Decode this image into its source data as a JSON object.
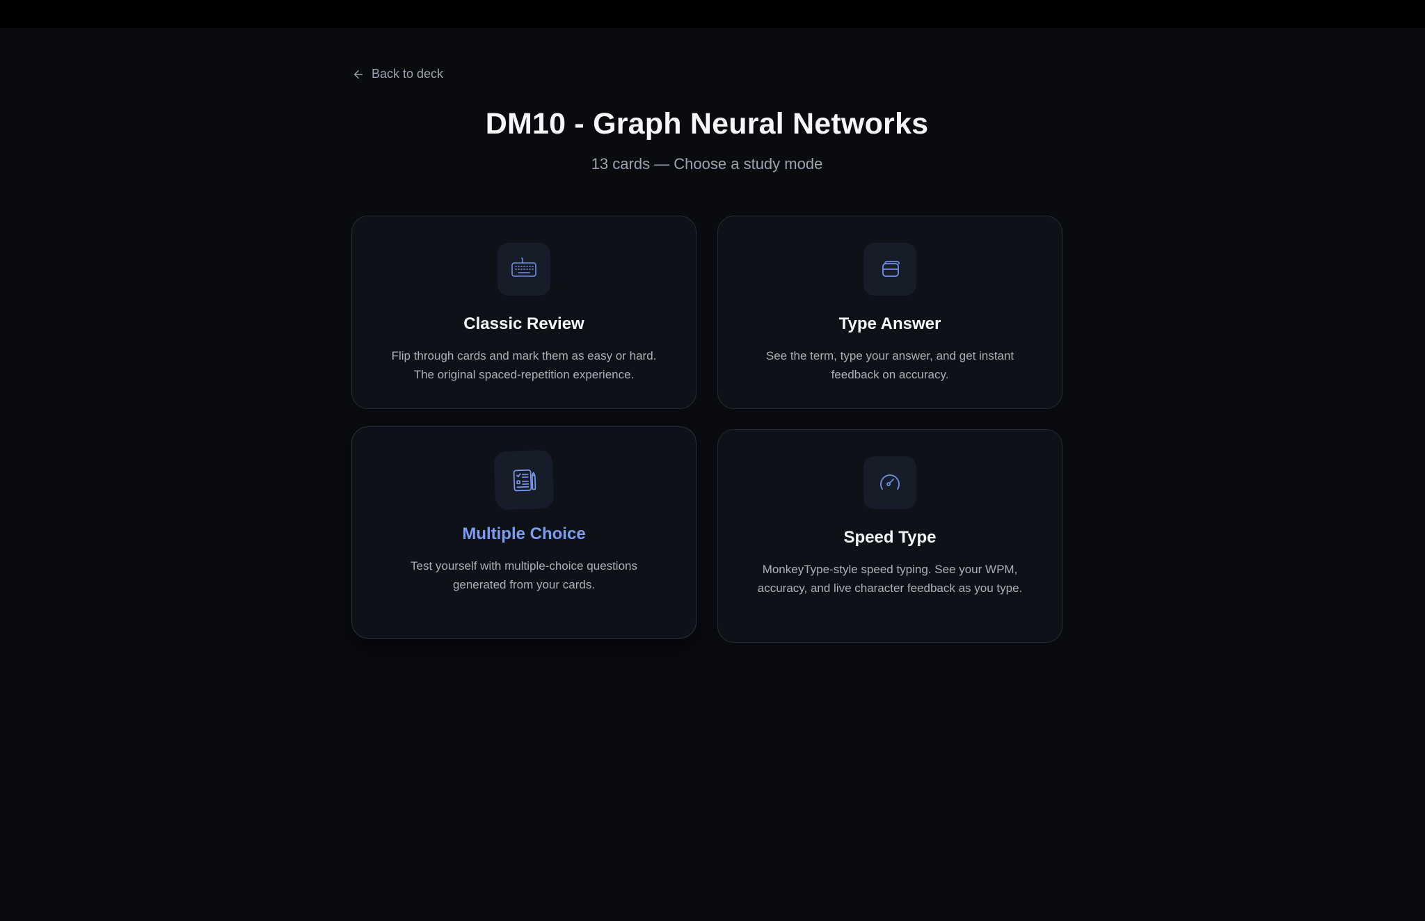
{
  "nav": {
    "back_label": "Back to deck"
  },
  "header": {
    "title": "DM10 - Graph Neural Networks",
    "subtitle": "13 cards — Choose a study mode"
  },
  "modes": [
    {
      "title": "Classic Review",
      "description": "Flip through cards and mark them as easy or hard. The original spaced-repetition experience.",
      "icon": "keyboard-icon"
    },
    {
      "title": "Type Answer",
      "description": "See the term, type your answer, and get instant feedback on accuracy.",
      "icon": "card-icon"
    },
    {
      "title": "Multiple Choice",
      "description": "Test yourself with multiple-choice questions generated from your cards.",
      "icon": "checklist-icon"
    },
    {
      "title": "Speed Type",
      "description": "MonkeyType-style speed typing. See your WPM, accuracy, and live character feedback as you type.",
      "icon": "speedometer-icon"
    }
  ],
  "colors": {
    "background": "#090b0f",
    "card": "#0e1218",
    "accent": "#7b9cf0",
    "muted_text": "#9aa3b2"
  }
}
